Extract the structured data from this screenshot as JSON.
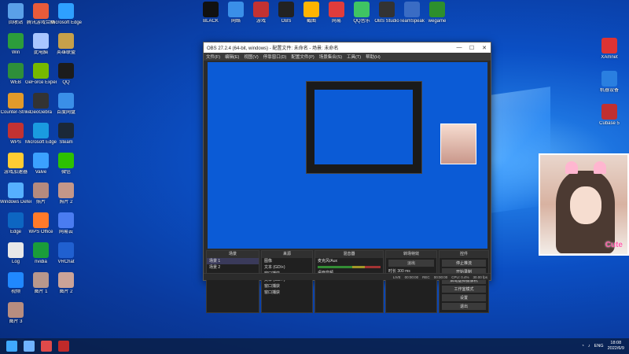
{
  "desktop": {
    "left_icons": [
      {
        "label": "回收站",
        "color": "#5aa0e8"
      },
      {
        "label": "腾讯游戏合集",
        "color": "#e85b3a"
      },
      {
        "label": "Microsoft Edge",
        "color": "#2ea0ff"
      },
      {
        "label": "Win",
        "color": "#2c9d3b"
      },
      {
        "label": "此电脑",
        "color": "#a9c6ff"
      },
      {
        "label": "英雄联盟",
        "color": "#c6a04a"
      },
      {
        "label": "WEB",
        "color": "#2e8f3a"
      },
      {
        "label": "GeForce Experience",
        "color": "#76b900"
      },
      {
        "label": "QQ",
        "color": "#1c1c1c"
      },
      {
        "label": "Counter-Strike",
        "color": "#e29a2a"
      },
      {
        "label": "GeoGebra",
        "color": "#333"
      },
      {
        "label": "百度网盘",
        "color": "#3a8fe8"
      },
      {
        "label": "WPS",
        "color": "#c23232"
      },
      {
        "label": "Microsoft Edge",
        "color": "#1a9be0"
      },
      {
        "label": "Steam",
        "color": "#1b2838"
      },
      {
        "label": "游戏加速器",
        "color": "#ffcc33"
      },
      {
        "label": "Valve",
        "color": "#3ba1ff"
      },
      {
        "label": "微信",
        "color": "#2dc100"
      },
      {
        "label": "Windows Defender",
        "color": "#56b0ff"
      },
      {
        "label": "照片",
        "color": "#b58a7e"
      },
      {
        "label": "照片 2",
        "color": "#c49789"
      },
      {
        "label": "Edge",
        "color": "#0d66c2"
      },
      {
        "label": "WPS Office",
        "color": "#ff7a2a"
      },
      {
        "label": "网易云",
        "color": "#4a7cf0"
      },
      {
        "label": "Log",
        "color": "#e8e8e8"
      },
      {
        "label": "nvidia",
        "color": "#1a9d3a"
      },
      {
        "label": "VRChat",
        "color": "#2060d0"
      },
      {
        "label": "视频",
        "color": "#2088ff"
      },
      {
        "label": "图片 1",
        "color": "#b8978c"
      },
      {
        "label": "图片 2",
        "color": "#cba398"
      },
      {
        "label": "图片 3",
        "color": "#b78d80"
      }
    ],
    "top_icons": [
      {
        "label": "BLACK",
        "color": "#111"
      },
      {
        "label": "网络",
        "color": "#3a8fe8"
      },
      {
        "label": "游戏",
        "color": "#c23232"
      },
      {
        "label": "OBS",
        "color": "#222"
      },
      {
        "label": "截图",
        "color": "#ffb400"
      },
      {
        "label": "网易",
        "color": "#e03c3c"
      },
      {
        "label": "QQ音乐",
        "color": "#3fc463"
      },
      {
        "label": "OBS Studio",
        "color": "#333"
      },
      {
        "label": "TeamSpeak",
        "color": "#3a6cc4"
      },
      {
        "label": "wegame",
        "color": "#2d8f2d"
      }
    ],
    "right_icons": [
      {
        "label": "XAmnet",
        "color": "#d33"
      },
      {
        "label": "机器设备",
        "color": "#2a7fe0"
      },
      {
        "label": "Cubase 5",
        "color": "#c03030"
      }
    ]
  },
  "obs": {
    "title": "OBS 27.2.4 (64-bit, windows) - 配置文件: 未命名 - 场景: 未命名",
    "menu": [
      "文件(F)",
      "编辑(E)",
      "视图(V)",
      "停靠窗口(D)",
      "配置文件(P)",
      "场景集合(S)",
      "工具(T)",
      "帮助(H)"
    ],
    "panels": {
      "scenes": {
        "title": "场景",
        "items": [
          "场景 1",
          "场景 2"
        ]
      },
      "sources": {
        "title": "来源",
        "items": [
          "图像",
          "文本 (GDI+)",
          "窗口捕获",
          "文本 (GDI+)",
          "窗口捕获",
          "窗口捕获"
        ]
      },
      "mixer": {
        "title": "混音器",
        "items": [
          "麦克风/Aux",
          "桌面音频"
        ]
      },
      "transitions": {
        "title": "转场特效",
        "type": "淡出",
        "duration_label": "时长",
        "duration": "300 ms"
      },
      "controls": {
        "title": "控件",
        "buttons": [
          "停止推流",
          "开始录制",
          "启动虚拟摄像机",
          "工作室模式",
          "设置",
          "退出"
        ]
      }
    },
    "status": {
      "live_label": "LIVE",
      "live_time": "00:00:00",
      "rec_label": "REC",
      "rec_time": "00:00:00",
      "cpu": "CPU: 0.4%",
      "fps": "30.00 fps"
    }
  },
  "webcam": {
    "overlay_text": "Cute"
  },
  "taskbar": {
    "items": [
      {
        "name": "start",
        "color": "#3fa9ff"
      },
      {
        "name": "search",
        "color": "#6fb3ff"
      },
      {
        "name": "app-x",
        "color": "#e04a4a"
      },
      {
        "name": "obs",
        "color": "#c02a2a"
      }
    ],
    "tray": {
      "lang": "ENG",
      "time": "18:08",
      "date": "2022/6/9"
    }
  }
}
